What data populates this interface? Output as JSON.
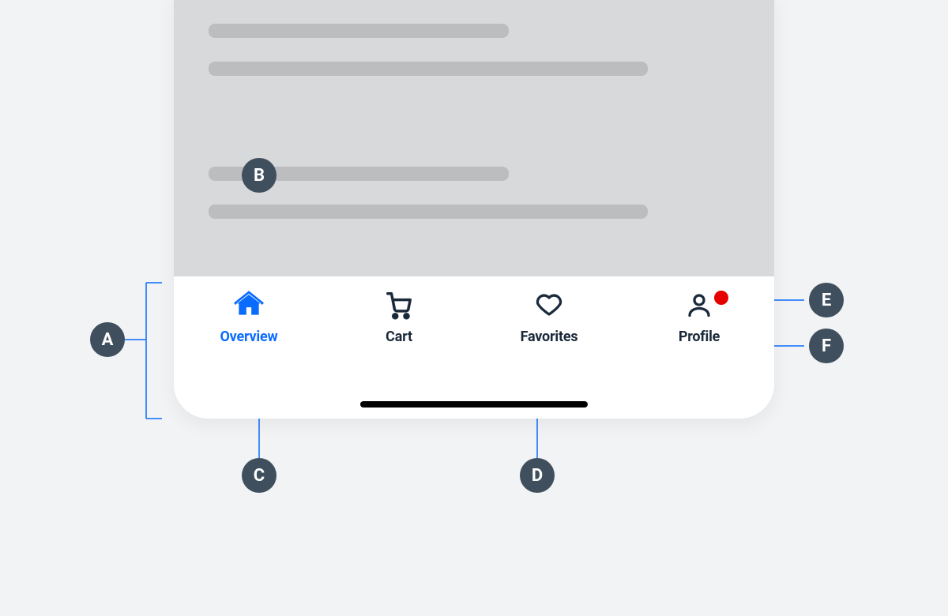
{
  "tabbar": {
    "items": [
      {
        "label": "Overview",
        "icon": "home",
        "active": true,
        "badge": false
      },
      {
        "label": "Cart",
        "icon": "cart",
        "active": false,
        "badge": false
      },
      {
        "label": "Favorites",
        "icon": "heart",
        "active": false,
        "badge": false
      },
      {
        "label": "Profile",
        "icon": "person",
        "active": false,
        "badge": true
      }
    ]
  },
  "callouts": {
    "A": "A",
    "B": "B",
    "C": "C",
    "D": "D",
    "E": "E",
    "F": "F"
  },
  "colors": {
    "accent": "#0a6cff",
    "callout_bg": "#3f4f5e",
    "badge": "#e60000",
    "skeleton": "#bcbdbf",
    "content_bg": "#d8d9db",
    "text": "#1b2a3a"
  }
}
